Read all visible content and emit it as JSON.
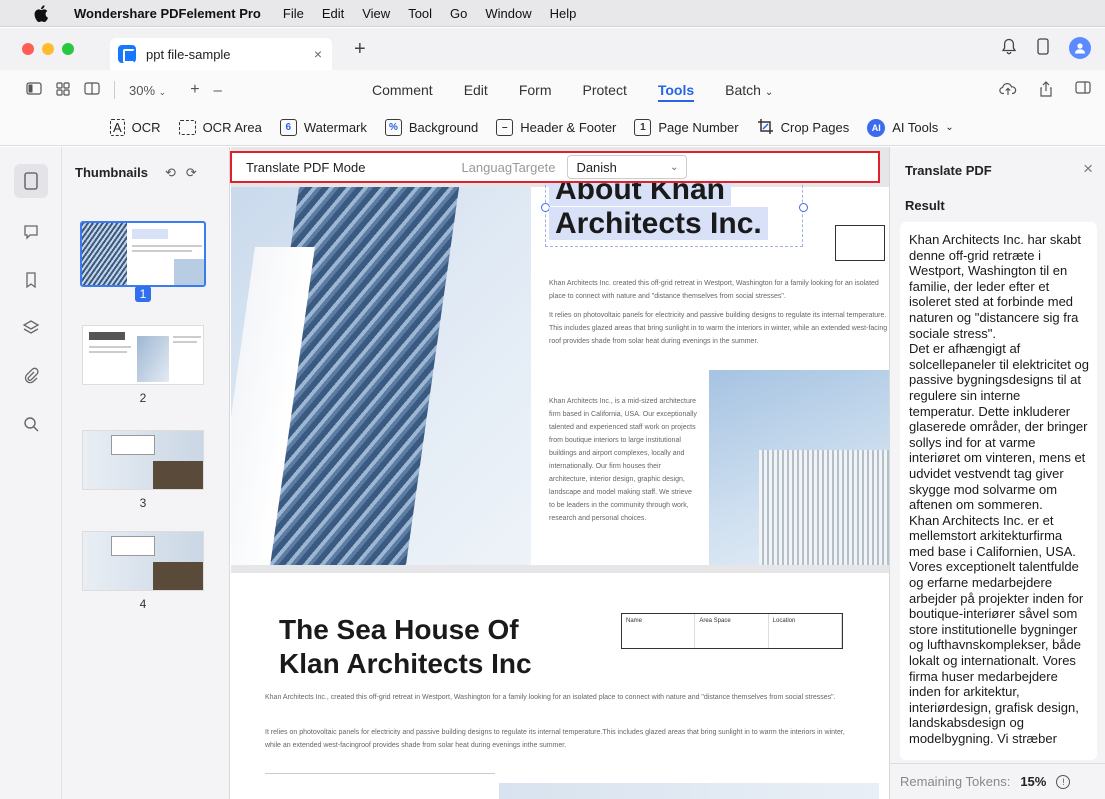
{
  "menubar": {
    "app_name": "Wondershare PDFelement Pro",
    "items": [
      "File",
      "Edit",
      "View",
      "Tool",
      "Go",
      "Window",
      "Help"
    ]
  },
  "tab": {
    "title": "ppt file-sample",
    "close": "×",
    "new": "+"
  },
  "toolbar": {
    "zoom": "30%",
    "zoom_in": "+",
    "zoom_out": "–",
    "menu": [
      "Comment",
      "Edit",
      "Form",
      "Protect",
      "Tools",
      "Batch"
    ],
    "active": "Tools"
  },
  "subtoolbar": {
    "ocr": "OCR",
    "ocr_area": "OCR Area",
    "watermark": "Watermark",
    "background": "Background",
    "header_footer": "Header & Footer",
    "page_number": "Page Number",
    "crop_pages": "Crop Pages",
    "ai_tools": "AI Tools",
    "ai_badge": "AI"
  },
  "thumbnails": {
    "header": "Thumbnails",
    "pages": [
      "1",
      "2",
      "3",
      "4"
    ],
    "selected": "1"
  },
  "translate_bar": {
    "mode_label": "Translate PDF Mode",
    "language_label": "LanguagTargete",
    "language_value": "Danish"
  },
  "document": {
    "page1_title_line1": "About Khan",
    "page1_title_line2": "Architects Inc.",
    "page1_para1": "Khan Architects Inc. created this off-grid retreat in Westport, Washington for a family looking for an isolated place to connect with nature and \"distance themselves from social stresses\".",
    "page1_para2": "It relies on photovoltaic panels for electricity and passive building designs to regulate its internal temperature. This includes glazed areas that bring sunlight in to warm the interiors in winter, while an extended west-facing roof provides shade from solar heat during evenings in the summer.",
    "page1_para3": "Khan Architects Inc., is a mid-sized architecture firm based in California, USA. Our exceptionally talented and experienced staff work on projects from boutique interiors to large institutional buildings and airport complexes, locally and internationally. Our firm houses their architecture, interior design, graphic design, landscape and model making staff. We strieve to be leaders in the community through work, research and personal choices.",
    "page2_title_line1": "The Sea House Of",
    "page2_title_line2": "Klan Architects Inc",
    "info_headers": [
      "Name",
      "Area Space",
      "Location"
    ],
    "page2_para1": "Khan Architects Inc., created this off-grid retreat in Westport, Washington for a family looking for an isolated place to connect with nature and \"distance themselves from social stresses\".",
    "page2_para2": "It relies on photovoltaic panels for electricity and passive building designs to regulate its internal temperature.This includes glazed areas that bring sunlight in to warm the interiors in winter, while an extended west-facingroof provides shade from solar heat during evenings inthe summer."
  },
  "panel": {
    "title": "Translate PDF",
    "close": "×",
    "result_label": "Result",
    "paragraphs": [
      "Khan Architects Inc. har skabt denne off-grid retræte i Westport, Washington til en familie, der leder efter et isoleret sted at forbinde med naturen og \"distancere sig fra sociale stress\".",
      "Det er afhængigt af solcellepaneler til elektricitet og passive bygningsdesigns til at regulere sin interne temperatur. Dette inkluderer glaserede områder, der bringer sollys ind for at varme interiøret om vinteren, mens et udvidet vestvendt tag giver skygge mod solvarme om aftenen om sommeren.",
      "Khan Architects Inc. er et mellemstort arkitekturfirma med base i Californien, USA. Vores exceptionelt talentfulde og erfarne medarbejdere arbejder på projekter inden for boutique-interiører såvel som store institutionelle bygninger og lufthavnskomplekser, både lokalt og internationalt. Vores firma huser medarbejdere inden for arkitektur, interiørdesign, grafisk design, landskabsdesign og modelbygning. Vi stræber"
    ],
    "tokens_label": "Remaining Tokens:",
    "tokens_value": "15%"
  },
  "colors": {
    "accent": "#2864e6",
    "highlight_border": "#e0202a"
  }
}
